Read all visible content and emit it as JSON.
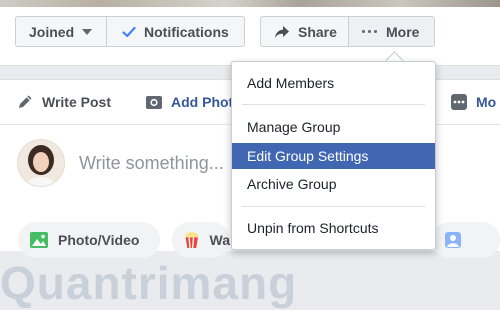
{
  "group_actions": {
    "joined_label": "Joined",
    "notifications_label": "Notifications",
    "share_label": "Share",
    "more_label": "More"
  },
  "composer": {
    "tabs": [
      {
        "label": "Write Post",
        "icon": "pencil-icon"
      },
      {
        "label": "Add Photo",
        "icon": "camera-icon"
      },
      {
        "label": "Mo",
        "icon": "more-grid-icon"
      }
    ],
    "placeholder": "Write something...",
    "attachments": [
      {
        "label": "Photo/Video",
        "icon": "photo-icon"
      },
      {
        "label": "Wa",
        "icon": "popcorn-icon"
      }
    ]
  },
  "more_menu": {
    "items": [
      {
        "label": "Add Members"
      },
      {
        "label": "Manage Group"
      },
      {
        "label": "Edit Group Settings",
        "highlighted": true
      },
      {
        "label": "Archive Group"
      },
      {
        "label": "Unpin from Shortcuts"
      }
    ]
  },
  "watermark": "Quantrimang",
  "colors": {
    "accent": "#4267b2",
    "link": "#365899",
    "check": "#4080ff",
    "text": "#4b4f56"
  }
}
